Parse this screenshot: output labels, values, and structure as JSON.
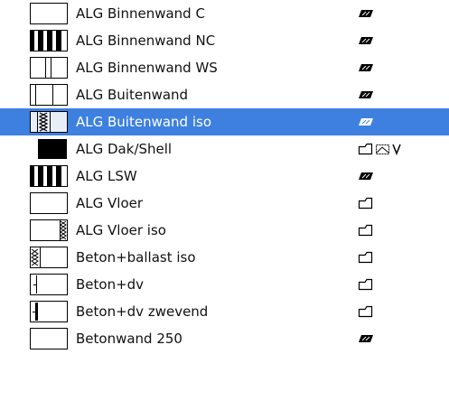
{
  "colors": {
    "selection": "#3d80df",
    "selected_text": "#ffffff"
  },
  "rows": [
    {
      "label": "ALG Binnenwand C",
      "swatch": "empty-frame",
      "icons": [
        "wall-icon"
      ]
    },
    {
      "label": "ALG Binnenwand NC",
      "swatch": "three-bars",
      "icons": [
        "wall-icon"
      ]
    },
    {
      "label": "ALG Binnenwand WS",
      "swatch": "double-center-line",
      "icons": [
        "wall-icon"
      ]
    },
    {
      "label": "ALG Buitenwand",
      "swatch": "two-lines",
      "icons": [
        "wall-icon"
      ]
    },
    {
      "label": "ALG Buitenwand iso",
      "swatch": "insulation",
      "icons": [
        "wall-icon"
      ],
      "selected": true
    },
    {
      "label": "ALG Dak/Shell",
      "swatch": "solid-black",
      "icons": [
        "slab-icon",
        "roof-icon",
        "shell-icon"
      ]
    },
    {
      "label": "ALG LSW",
      "swatch": "three-bars",
      "icons": [
        "wall-icon"
      ]
    },
    {
      "label": "ALG Vloer",
      "swatch": "empty-frame",
      "icons": [
        "slab-icon"
      ]
    },
    {
      "label": "ALG Vloer iso",
      "swatch": "insulation-right",
      "icons": [
        "slab-icon"
      ]
    },
    {
      "label": "Beton+ballast iso",
      "swatch": "left-insulation",
      "icons": [
        "slab-icon"
      ]
    },
    {
      "label": "Beton+dv",
      "swatch": "left-line",
      "icons": [
        "slab-icon"
      ]
    },
    {
      "label": "Beton+dv zwevend",
      "swatch": "left-bold-line",
      "icons": [
        "slab-icon"
      ]
    },
    {
      "label": "Betonwand 250",
      "swatch": "empty-frame",
      "icons": [
        "wall-icon"
      ]
    }
  ]
}
